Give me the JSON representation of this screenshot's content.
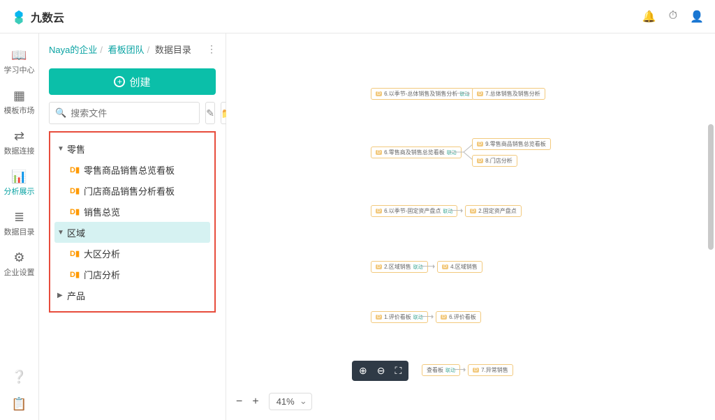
{
  "logo_text": "九数云",
  "header_icons": {
    "bell": "🔔",
    "timer": "⏱",
    "user": "👤"
  },
  "rail": [
    {
      "icon": "📖",
      "label": "学习中心"
    },
    {
      "icon": "▦",
      "label": "模板市场"
    },
    {
      "icon": "⇄",
      "label": "数据连接"
    },
    {
      "icon": "⫿",
      "label": "分析展示"
    },
    {
      "icon": "≣",
      "label": "数据目录"
    },
    {
      "icon": "⚙",
      "label": "企业设置"
    }
  ],
  "breadcrumb": {
    "a": "Naya的企业",
    "b": "看板团队",
    "c": "数据目录"
  },
  "create_label": "创建",
  "search_placeholder": "搜索文件",
  "tree": {
    "g1": {
      "label": "零售"
    },
    "g1_c1": "零售商品销售总览看板",
    "g1_c2": "门店商品销售分析看板",
    "g1_c3": "销售总览",
    "g2": {
      "label": "区域"
    },
    "g2_c1": "大区分析",
    "g2_c2": "门店分析",
    "g3": {
      "label": "产品"
    }
  },
  "zoom_pct": "41%",
  "nodes": {
    "n1": "6.以季节-总体销售及销售分析",
    "n2": "7.总体销售及销售分析",
    "n3": "6.零售商及销售总览看板",
    "n4": "9.零售商品销售总览看板",
    "n5": "8.门店分析",
    "n6": "6.以季节-固定资产盘点",
    "n7": "2.固定资产盘点",
    "n8": "2.区域销售",
    "n9": "4.区域销售",
    "n10": "1.评价看板",
    "n11": "6.评价看板",
    "n12": "查看板",
    "n13": "7.异常销售"
  }
}
